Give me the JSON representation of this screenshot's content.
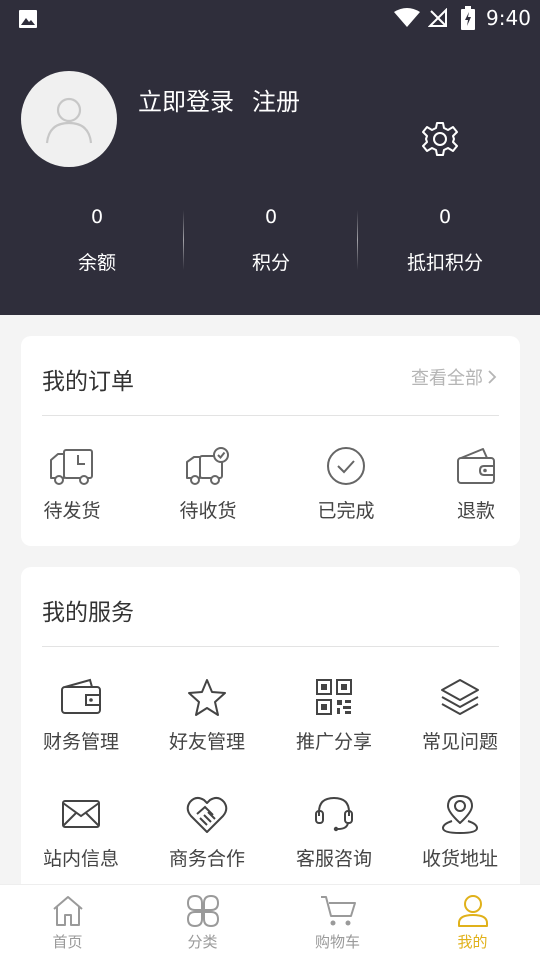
{
  "status_bar": {
    "time": "9:40"
  },
  "header": {
    "login_label": "立即登录",
    "register_label": "注册",
    "stats": [
      {
        "value": "0",
        "label": "余额"
      },
      {
        "value": "0",
        "label": "积分"
      },
      {
        "value": "0",
        "label": "抵扣积分"
      }
    ]
  },
  "orders": {
    "title": "我的订单",
    "view_all": "查看全部",
    "items": [
      {
        "label": "待发货",
        "icon": "truck-clock-icon"
      },
      {
        "label": "待收货",
        "icon": "truck-check-icon"
      },
      {
        "label": "已完成",
        "icon": "check-circle-icon"
      },
      {
        "label": "退款",
        "icon": "wallet-refund-icon"
      }
    ]
  },
  "services": {
    "title": "我的服务",
    "items": [
      {
        "label": "财务管理",
        "icon": "wallet-icon"
      },
      {
        "label": "好友管理",
        "icon": "star-icon"
      },
      {
        "label": "推广分享",
        "icon": "qrcode-icon"
      },
      {
        "label": "常见问题",
        "icon": "layers-icon"
      },
      {
        "label": "站内信息",
        "icon": "mail-icon"
      },
      {
        "label": "商务合作",
        "icon": "handshake-icon"
      },
      {
        "label": "客服咨询",
        "icon": "headset-icon"
      },
      {
        "label": "收货地址",
        "icon": "location-pin-icon"
      }
    ]
  },
  "tabbar": {
    "active": "我的",
    "items": [
      {
        "label": "首页",
        "icon": "home-icon"
      },
      {
        "label": "分类",
        "icon": "category-icon"
      },
      {
        "label": "购物车",
        "icon": "cart-icon"
      },
      {
        "label": "我的",
        "icon": "user-icon"
      }
    ]
  },
  "colors": {
    "header_bg": "#2f2e3b",
    "accent": "#e0b11a",
    "page_bg": "#f4f4f4"
  }
}
